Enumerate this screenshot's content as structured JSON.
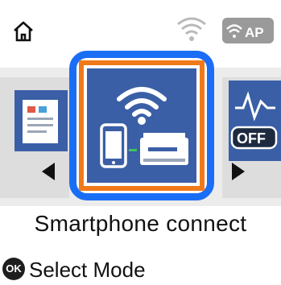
{
  "status_bar": {
    "home_icon": "home-icon",
    "wifi_icon": "wifi-icon",
    "wifi_direct_badge": "AP"
  },
  "carousel": {
    "left_item_icon": "document-icon",
    "right_item_icon": "power-off-icon",
    "right_item_label": "OFF",
    "selected_item_icon": "smartphone-printer-wifi-icon",
    "selected_label": "Smartphone connect",
    "focus_color": "#1a6ef5",
    "highlight_color": "#f07a1a",
    "tile_color": "#3a5fa6"
  },
  "hint": {
    "button_label": "OK",
    "action_text": "Select Mode"
  }
}
